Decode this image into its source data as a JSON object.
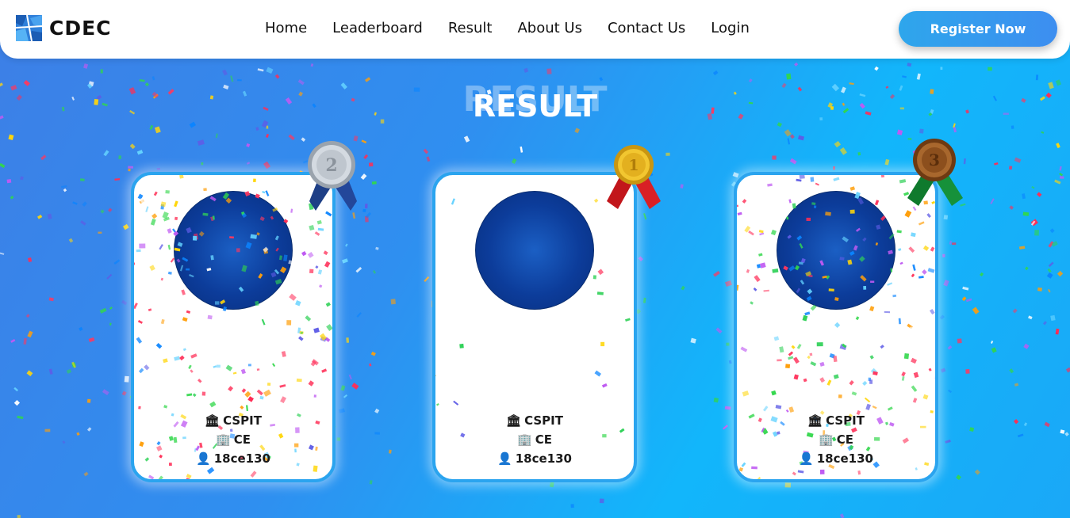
{
  "nav": {
    "brand": "CDEC",
    "links": [
      "Home",
      "Leaderboard",
      "Result",
      "About Us",
      "Contact Us",
      "Login"
    ],
    "register_label": "Register Now"
  },
  "page": {
    "title": "RESULT"
  },
  "cards": [
    {
      "rank": "2",
      "medal": "silver-medal-icon",
      "college": "CSPIT",
      "department": "CE",
      "id": "18ce130"
    },
    {
      "rank": "1",
      "medal": "gold-medal-icon",
      "college": "CSPIT",
      "department": "CE",
      "id": "18ce130"
    },
    {
      "rank": "3",
      "medal": "bronze-medal-icon",
      "college": "CSPIT",
      "department": "CE",
      "id": "18ce130"
    }
  ],
  "colors": {
    "accent": "#2aa4ef",
    "silver": "#c8cfd8",
    "gold": "#e6b320",
    "bronze": "#9a5a24"
  }
}
